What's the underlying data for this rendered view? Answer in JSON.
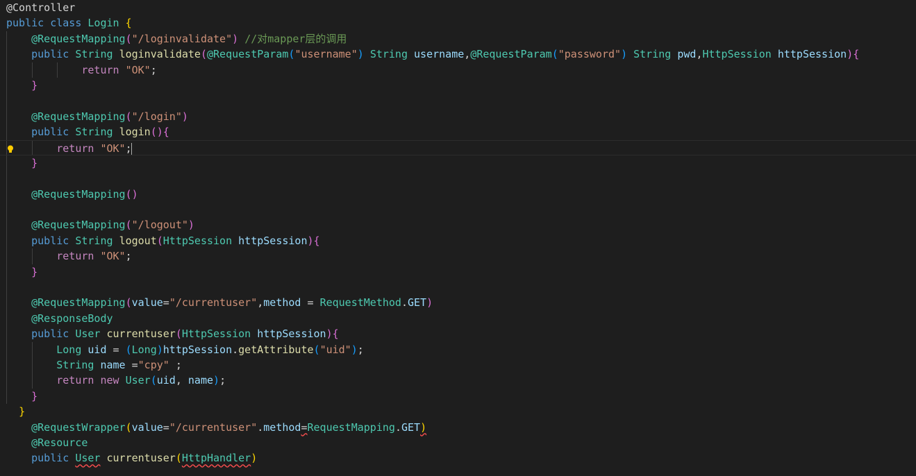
{
  "lines": [
    [
      [
        "tx",
        "@Controller"
      ]
    ],
    [
      [
        "k",
        "public"
      ],
      [
        "tx",
        " "
      ],
      [
        "k",
        "class"
      ],
      [
        "tx",
        " "
      ],
      [
        "cl",
        "Login"
      ],
      [
        "tx",
        " "
      ],
      [
        "p1",
        "{"
      ]
    ],
    [
      [
        "tx",
        "    "
      ],
      [
        "an",
        "@RequestMapping"
      ],
      [
        "p2",
        "("
      ],
      [
        "st",
        "\"/loginvalidate\""
      ],
      [
        "p2",
        ")"
      ],
      [
        "tx",
        " "
      ],
      [
        "cm",
        "//对mapper层的调用"
      ]
    ],
    [
      [
        "tx",
        "    "
      ],
      [
        "k",
        "public"
      ],
      [
        "tx",
        " "
      ],
      [
        "ty",
        "String"
      ],
      [
        "tx",
        " "
      ],
      [
        "fn",
        "loginvalidate"
      ],
      [
        "p2",
        "("
      ],
      [
        "an",
        "@RequestParam"
      ],
      [
        "p3",
        "("
      ],
      [
        "st",
        "\"username\""
      ],
      [
        "p3",
        ")"
      ],
      [
        "tx",
        " "
      ],
      [
        "ty",
        "String"
      ],
      [
        "tx",
        " "
      ],
      [
        "va",
        "username"
      ],
      [
        "tx",
        ","
      ],
      [
        "an",
        "@RequestParam"
      ],
      [
        "p3",
        "("
      ],
      [
        "st",
        "\"password\""
      ],
      [
        "p3",
        ")"
      ],
      [
        "tx",
        " "
      ],
      [
        "ty",
        "String"
      ],
      [
        "tx",
        " "
      ],
      [
        "va",
        "pwd"
      ],
      [
        "tx",
        ","
      ],
      [
        "ty",
        "HttpSession"
      ],
      [
        "tx",
        " "
      ],
      [
        "va",
        "httpSession"
      ],
      [
        "p2",
        ")"
      ],
      [
        "p2",
        "{"
      ]
    ],
    [
      [
        "tx",
        "            "
      ],
      [
        "kc",
        "return"
      ],
      [
        "tx",
        " "
      ],
      [
        "st",
        "\"OK\""
      ],
      [
        "tx",
        ";"
      ]
    ],
    [
      [
        "tx",
        "    "
      ],
      [
        "p2",
        "}"
      ]
    ],
    [
      [
        "tx",
        ""
      ]
    ],
    [
      [
        "tx",
        "    "
      ],
      [
        "an",
        "@RequestMapping"
      ],
      [
        "p2",
        "("
      ],
      [
        "st",
        "\"/login\""
      ],
      [
        "p2",
        ")"
      ]
    ],
    [
      [
        "tx",
        "    "
      ],
      [
        "k",
        "public"
      ],
      [
        "tx",
        " "
      ],
      [
        "ty",
        "String"
      ],
      [
        "tx",
        " "
      ],
      [
        "fn",
        "login"
      ],
      [
        "p2",
        "()"
      ],
      [
        "p2",
        "{"
      ]
    ],
    [
      [
        "tx",
        "        "
      ],
      [
        "kc",
        "return"
      ],
      [
        "tx",
        " "
      ],
      [
        "st",
        "\"OK\""
      ],
      [
        "tx",
        ";"
      ]
    ],
    [
      [
        "tx",
        "    "
      ],
      [
        "p2",
        "}"
      ]
    ],
    [
      [
        "tx",
        ""
      ]
    ],
    [
      [
        "tx",
        "    "
      ],
      [
        "an",
        "@RequestMapping"
      ],
      [
        "p2",
        "()"
      ]
    ],
    [
      [
        "tx",
        ""
      ]
    ],
    [
      [
        "tx",
        "    "
      ],
      [
        "an",
        "@RequestMapping"
      ],
      [
        "p2",
        "("
      ],
      [
        "st",
        "\"/logout\""
      ],
      [
        "p2",
        ")"
      ]
    ],
    [
      [
        "tx",
        "    "
      ],
      [
        "k",
        "public"
      ],
      [
        "tx",
        " "
      ],
      [
        "ty",
        "String"
      ],
      [
        "tx",
        " "
      ],
      [
        "fn",
        "logout"
      ],
      [
        "p2",
        "("
      ],
      [
        "ty",
        "HttpSession"
      ],
      [
        "tx",
        " "
      ],
      [
        "va",
        "httpSession"
      ],
      [
        "p2",
        ")"
      ],
      [
        "p2",
        "{"
      ]
    ],
    [
      [
        "tx",
        "        "
      ],
      [
        "kc",
        "return"
      ],
      [
        "tx",
        " "
      ],
      [
        "st",
        "\"OK\""
      ],
      [
        "tx",
        ";"
      ]
    ],
    [
      [
        "tx",
        "    "
      ],
      [
        "p2",
        "}"
      ]
    ],
    [
      [
        "tx",
        ""
      ]
    ],
    [
      [
        "tx",
        "    "
      ],
      [
        "an",
        "@RequestMapping"
      ],
      [
        "p2",
        "("
      ],
      [
        "va",
        "value"
      ],
      [
        "tx",
        "="
      ],
      [
        "st",
        "\"/currentuser\""
      ],
      [
        "tx",
        ","
      ],
      [
        "va",
        "method"
      ],
      [
        "tx",
        " = "
      ],
      [
        "cl",
        "RequestMethod"
      ],
      [
        "tx",
        "."
      ],
      [
        "va",
        "GET"
      ],
      [
        "p2",
        ")"
      ]
    ],
    [
      [
        "tx",
        "    "
      ],
      [
        "an",
        "@ResponseBody"
      ]
    ],
    [
      [
        "tx",
        "    "
      ],
      [
        "k",
        "public"
      ],
      [
        "tx",
        " "
      ],
      [
        "ty",
        "User"
      ],
      [
        "tx",
        " "
      ],
      [
        "fn",
        "currentuser"
      ],
      [
        "p2",
        "("
      ],
      [
        "ty",
        "HttpSession"
      ],
      [
        "tx",
        " "
      ],
      [
        "va",
        "httpSession"
      ],
      [
        "p2",
        ")"
      ],
      [
        "p2",
        "{"
      ]
    ],
    [
      [
        "tx",
        "        "
      ],
      [
        "ty",
        "Long"
      ],
      [
        "tx",
        " "
      ],
      [
        "va",
        "uid"
      ],
      [
        "tx",
        " = "
      ],
      [
        "p3",
        "("
      ],
      [
        "ty",
        "Long"
      ],
      [
        "p3",
        ")"
      ],
      [
        "va",
        "httpSession"
      ],
      [
        "tx",
        "."
      ],
      [
        "fn",
        "getAttribute"
      ],
      [
        "p3",
        "("
      ],
      [
        "st",
        "\"uid\""
      ],
      [
        "p3",
        ")"
      ],
      [
        "tx",
        ";"
      ]
    ],
    [
      [
        "tx",
        "        "
      ],
      [
        "ty",
        "String"
      ],
      [
        "tx",
        " "
      ],
      [
        "va",
        "name"
      ],
      [
        "tx",
        " ="
      ],
      [
        "st",
        "\"cpy\""
      ],
      [
        "tx",
        " ;"
      ]
    ],
    [
      [
        "tx",
        "        "
      ],
      [
        "kc",
        "return"
      ],
      [
        "tx",
        " "
      ],
      [
        "kc",
        "new"
      ],
      [
        "tx",
        " "
      ],
      [
        "cl",
        "User"
      ],
      [
        "p3",
        "("
      ],
      [
        "va",
        "uid"
      ],
      [
        "tx",
        ", "
      ],
      [
        "va",
        "name"
      ],
      [
        "p3",
        ")"
      ],
      [
        "tx",
        ";"
      ]
    ],
    [
      [
        "tx",
        "    "
      ],
      [
        "p2",
        "}"
      ]
    ],
    [
      [
        "tx",
        "  "
      ],
      [
        "p1",
        "}"
      ]
    ],
    [
      [
        "tx",
        "    "
      ],
      [
        "an",
        "@RequestWrapper"
      ],
      [
        "p1",
        "("
      ],
      [
        "va",
        "value"
      ],
      [
        "tx",
        "="
      ],
      [
        "st",
        "\"/currentuser\""
      ],
      [
        "tx",
        "."
      ],
      [
        "va",
        "method"
      ],
      [
        "tx",
        "="
      ],
      [
        "cl",
        "RequestMapping"
      ],
      [
        "tx",
        "."
      ],
      [
        "va",
        "GET"
      ],
      [
        "p1",
        ")"
      ]
    ],
    [
      [
        "tx",
        "    "
      ],
      [
        "an",
        "@Resource"
      ]
    ],
    [
      [
        "tx",
        "    "
      ],
      [
        "k",
        "public"
      ],
      [
        "tx",
        " "
      ],
      [
        "ty",
        "User"
      ],
      [
        "tx",
        " "
      ],
      [
        "fn",
        "currentuser"
      ],
      [
        "p1",
        "("
      ],
      [
        "ty",
        "HttpHandler"
      ],
      [
        "p1",
        ")"
      ]
    ]
  ],
  "theme": {
    "background": "#1e1e1e",
    "indent_guide": "#404040",
    "lightbulb": "#ffcc00"
  },
  "icons": {
    "gutter": "lightbulb-icon"
  }
}
